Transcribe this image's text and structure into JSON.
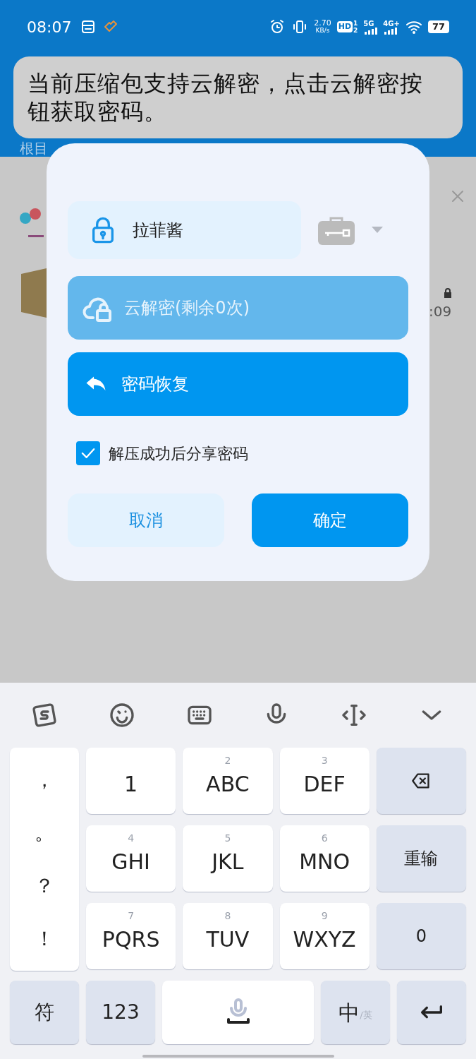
{
  "status_bar": {
    "time": "08:07",
    "net_speed": "2.70",
    "net_unit": "KB/s",
    "hd": "HD",
    "sim_slots": [
      "1",
      "2"
    ],
    "networks": [
      "5G",
      "4G+"
    ],
    "battery": "77"
  },
  "background": {
    "breadcrumb": "根目",
    "file_time": ":09"
  },
  "toast": {
    "text": "当前压缩包支持云解密，点击云解密按钮获取密码。"
  },
  "dialog": {
    "password": {
      "value": "拉菲酱"
    },
    "cloud_button": {
      "label": "云解密(剩余0次)",
      "disabled": true
    },
    "recover_button": {
      "label": "密码恢复"
    },
    "share_checkbox": {
      "label": "解压成功后分享密码",
      "checked": true
    },
    "buttons": [
      {
        "label": "取消",
        "kind": "secondary"
      },
      {
        "label": "确定",
        "kind": "primary"
      }
    ]
  },
  "keyboard": {
    "symbols": [
      "，",
      "。",
      "？",
      "！"
    ],
    "rows": [
      [
        {
          "label": "1",
          "kind": "letter"
        },
        {
          "digit": "2",
          "label": "ABC",
          "kind": "letter"
        },
        {
          "digit": "3",
          "label": "DEF",
          "kind": "letter"
        },
        {
          "kind": "backspace"
        }
      ],
      [
        {
          "digit": "4",
          "label": "GHI",
          "kind": "letter"
        },
        {
          "digit": "5",
          "label": "JKL",
          "kind": "letter"
        },
        {
          "digit": "6",
          "label": "MNO",
          "kind": "letter"
        },
        {
          "label": "重输",
          "kind": "function"
        }
      ],
      [
        {
          "digit": "7",
          "label": "PQRS",
          "kind": "letter"
        },
        {
          "digit": "8",
          "label": "TUV",
          "kind": "letter"
        },
        {
          "digit": "9",
          "label": "WXYZ",
          "kind": "letter"
        },
        {
          "label": "0",
          "kind": "function"
        }
      ]
    ],
    "bottom": {
      "symbol_key": "符",
      "number_key": "123",
      "lang_key": "中",
      "lang_alt": "/英"
    }
  }
}
